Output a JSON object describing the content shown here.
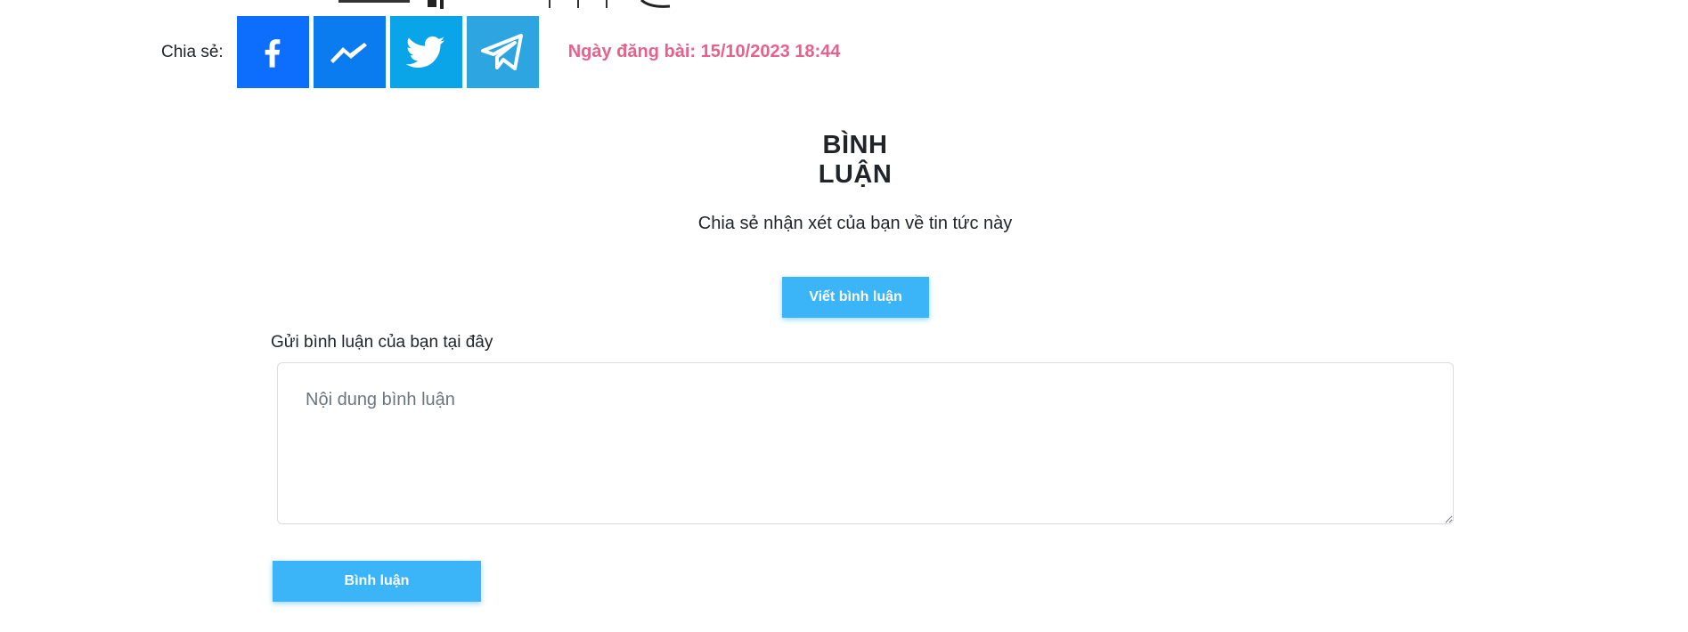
{
  "share": {
    "label": "Chia sẻ:",
    "buttons": [
      {
        "name": "facebook",
        "icon": "facebook-icon",
        "color": "#0d6efd"
      },
      {
        "name": "messenger",
        "icon": "messenger-icon",
        "color": "#0b7bf0"
      },
      {
        "name": "twitter",
        "icon": "twitter-icon",
        "color": "#0aa5e8"
      },
      {
        "name": "telegram",
        "icon": "telegram-icon",
        "color": "#2ca5e0"
      }
    ],
    "post_date": "Ngày đăng bài: 15/10/2023 18:44",
    "post_date_color": "#e8618c"
  },
  "comments": {
    "title": "BÌNH LUẬN",
    "subtitle": "Chia sẻ nhận xét của bạn về tin tức này",
    "write_button": "Viết bình luận",
    "form_label": "Gửi bình luận của bạn tại đây",
    "textarea_placeholder": "Nội dung bình luận",
    "textarea_value": "",
    "submit_button": "Bình luận",
    "accent_color": "#3bb4f8"
  }
}
